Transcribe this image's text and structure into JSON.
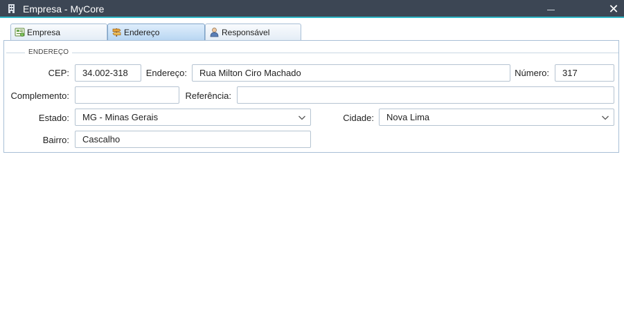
{
  "window": {
    "title": "Empresa - MyCore",
    "title_icon": "building-icon"
  },
  "tabs": [
    {
      "label": "Empresa",
      "icon": "company-icon",
      "active": false
    },
    {
      "label": "Endereço",
      "icon": "signpost-icon",
      "active": true
    },
    {
      "label": "Responsável",
      "icon": "person-icon",
      "active": false
    }
  ],
  "section": {
    "legend": "ENDEREÇO"
  },
  "form": {
    "cep": {
      "label": "CEP:",
      "value": "34.002-318"
    },
    "endereco": {
      "label": "Endereço:",
      "value": "Rua Milton Ciro Machado"
    },
    "numero": {
      "label": "Número:",
      "value": "317"
    },
    "complemento": {
      "label": "Complemento:",
      "value": ""
    },
    "referencia": {
      "label": "Referência:",
      "value": ""
    },
    "estado": {
      "label": "Estado:",
      "value": "MG - Minas Gerais"
    },
    "cidade": {
      "label": "Cidade:",
      "value": "Nova Lima"
    },
    "bairro": {
      "label": "Bairro:",
      "value": "Cascalho"
    }
  },
  "colors": {
    "titlebar": "#3c4654",
    "accent": "#2fb8c8",
    "tab_active": "#b9d6f2",
    "border": "#a8bfd6"
  }
}
